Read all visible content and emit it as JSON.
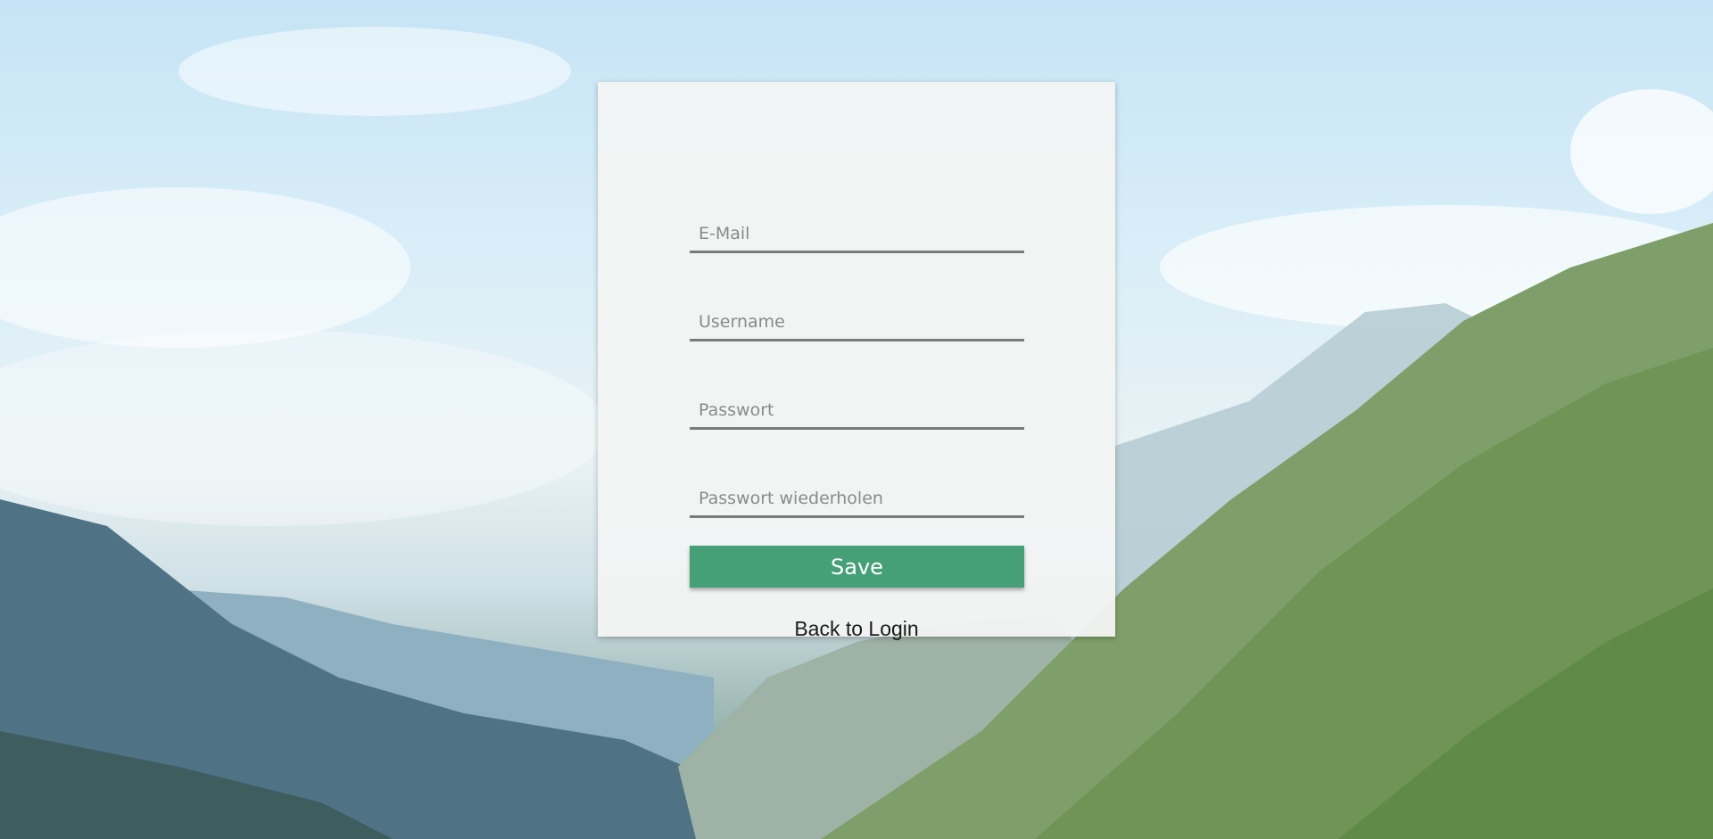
{
  "form": {
    "email": {
      "placeholder": "E-Mail",
      "value": ""
    },
    "username": {
      "placeholder": "Username",
      "value": ""
    },
    "password": {
      "placeholder": "Passwort",
      "value": ""
    },
    "password_repeat": {
      "placeholder": "Passwort wiederholen",
      "value": ""
    },
    "save_label": "Save",
    "back_label": "Back to Login"
  },
  "colors": {
    "save_button": "#45a077",
    "field_underline": "#7a7a7a",
    "card_background": "#f3f4f4"
  }
}
